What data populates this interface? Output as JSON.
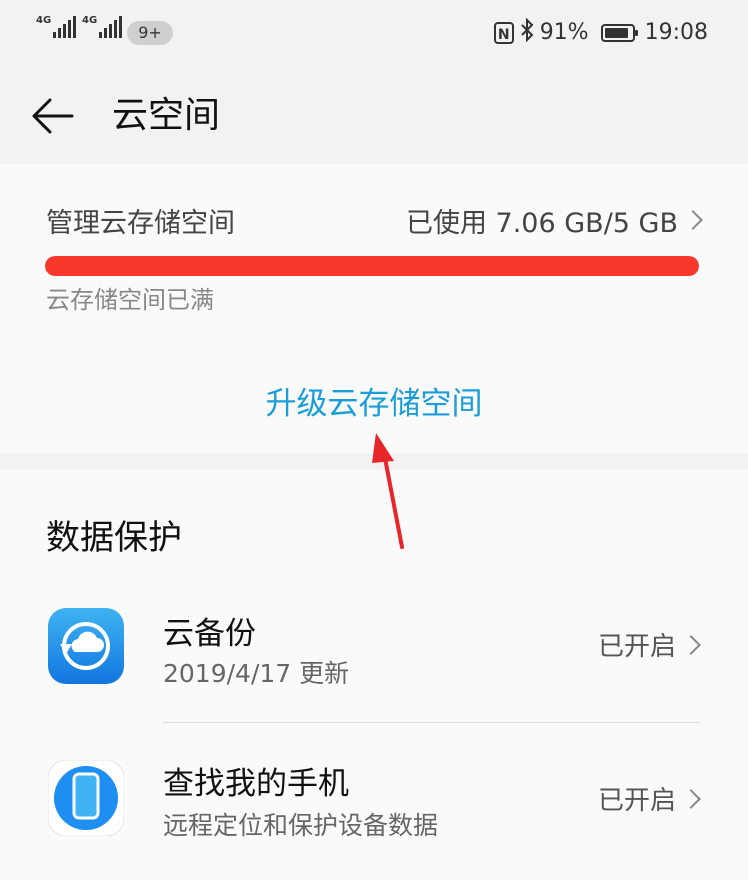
{
  "status_bar": {
    "sim1_label": "4G",
    "sim2_label": "4G",
    "badge": "9+",
    "nfc_icon": "N",
    "bluetooth_icon": "bluetooth-icon",
    "battery_percent_text": "91%",
    "battery_level": 0.91,
    "time": "19:08"
  },
  "header": {
    "back_icon": "back-arrow-icon",
    "title": "云空间"
  },
  "storage": {
    "manage_label": "管理云存储空间",
    "usage_text": "已使用 7.06 GB/5 GB",
    "usage_fraction": 1.0,
    "full_text": "云存储空间已满",
    "upgrade_label": "升级云存储空间",
    "bar_color": "#f7372a",
    "link_color": "#1a9ed9"
  },
  "data_protection": {
    "title": "数据保护",
    "items": [
      {
        "icon": "cloud-backup-icon",
        "title": "云备份",
        "subtitle": "2019/4/17 更新",
        "status": "已开启"
      },
      {
        "icon": "find-my-phone-icon",
        "title": "查找我的手机",
        "subtitle": "远程定位和保护设备数据",
        "status": "已开启"
      }
    ]
  }
}
